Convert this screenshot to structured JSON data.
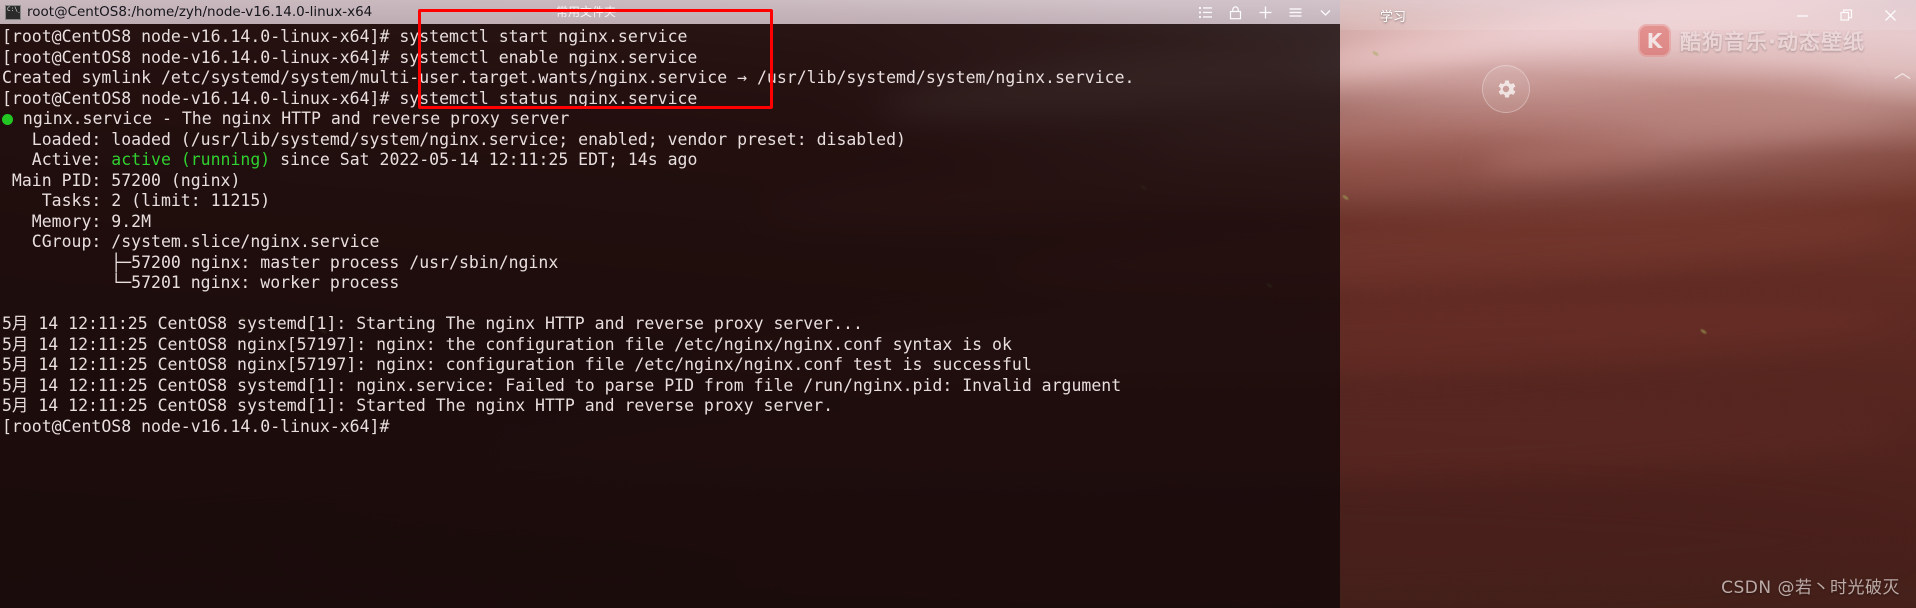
{
  "desktop": {
    "top_tab_label": "学习",
    "window_controls": [
      {
        "name": "minimize",
        "glyph": "minimize-icon"
      },
      {
        "name": "restore",
        "glyph": "restore-icon"
      },
      {
        "name": "close",
        "glyph": "close-icon"
      }
    ],
    "kugou": {
      "logo_letter": "K",
      "label": "酷狗音乐·动态壁纸"
    },
    "collapse_chevron": "︿",
    "watermark": "CSDN @若丶时光破灭"
  },
  "terminal": {
    "titlebar": {
      "title": "root@CentOS8:/home/zyh/node-v16.14.0-linux-x64",
      "icon_label": "C:\\_",
      "center_label": "常用文件夹",
      "tools": [
        {
          "name": "list-icon",
          "label": "list"
        },
        {
          "name": "lock-icon",
          "label": "lock"
        },
        {
          "name": "plus-icon",
          "label": "new tab"
        },
        {
          "name": "menu-icon",
          "label": "menu"
        },
        {
          "name": "chevron-down-icon",
          "label": "more"
        }
      ]
    },
    "prompt": "[root@CentOS8 node-v16.14.0-linux-x64]#",
    "lines": [
      {
        "type": "prompt",
        "command": " systemctl start nginx.service"
      },
      {
        "type": "prompt",
        "command": " systemctl enable nginx.service"
      },
      {
        "type": "plain",
        "text": "Created symlink /etc/systemd/system/multi-user.target.wants/nginx.service → /usr/lib/systemd/system/nginx.service."
      },
      {
        "type": "prompt",
        "command": " systemctl status nginx.service"
      },
      {
        "type": "status-head",
        "text": " nginx.service - The nginx HTTP and reverse proxy server"
      },
      {
        "type": "plain",
        "text": "   Loaded: loaded (/usr/lib/systemd/system/nginx.service; enabled; vendor preset: disabled)"
      },
      {
        "type": "active",
        "prefix": "   Active: ",
        "green": "active (running)",
        "suffix": " since Sat 2022-05-14 12:11:25 EDT; 14s ago"
      },
      {
        "type": "plain",
        "text": " Main PID: 57200 (nginx)"
      },
      {
        "type": "plain",
        "text": "    Tasks: 2 (limit: 11215)"
      },
      {
        "type": "plain",
        "text": "   Memory: 9.2M"
      },
      {
        "type": "plain",
        "text": "   CGroup: /system.slice/nginx.service"
      },
      {
        "type": "plain",
        "text": "           ├─57200 nginx: master process /usr/sbin/nginx"
      },
      {
        "type": "plain",
        "text": "           └─57201 nginx: worker process"
      },
      {
        "type": "blank",
        "text": ""
      },
      {
        "type": "plain",
        "text": "5月 14 12:11:25 CentOS8 systemd[1]: Starting The nginx HTTP and reverse proxy server..."
      },
      {
        "type": "plain",
        "text": "5月 14 12:11:25 CentOS8 nginx[57197]: nginx: the configuration file /etc/nginx/nginx.conf syntax is ok"
      },
      {
        "type": "plain",
        "text": "5月 14 12:11:25 CentOS8 nginx[57197]: nginx: configuration file /etc/nginx/nginx.conf test is successful"
      },
      {
        "type": "plain",
        "text": "5月 14 12:11:25 CentOS8 systemd[1]: nginx.service: Failed to parse PID from file /run/nginx.pid: Invalid argument"
      },
      {
        "type": "plain",
        "text": "5月 14 12:11:25 CentOS8 systemd[1]: Started The nginx HTTP and reverse proxy server."
      },
      {
        "type": "prompt",
        "command": ""
      }
    ]
  },
  "annotation": {
    "highlight_color": "#ff0000",
    "highlighted_commands": [
      "systemctl start nginx.service",
      "systemctl enable nginx.service",
      "systemctl status nginx.service"
    ]
  },
  "colors": {
    "green": "#2fd02f",
    "terminal_fg": "#e8dede",
    "annotation_red": "#ff0000"
  }
}
